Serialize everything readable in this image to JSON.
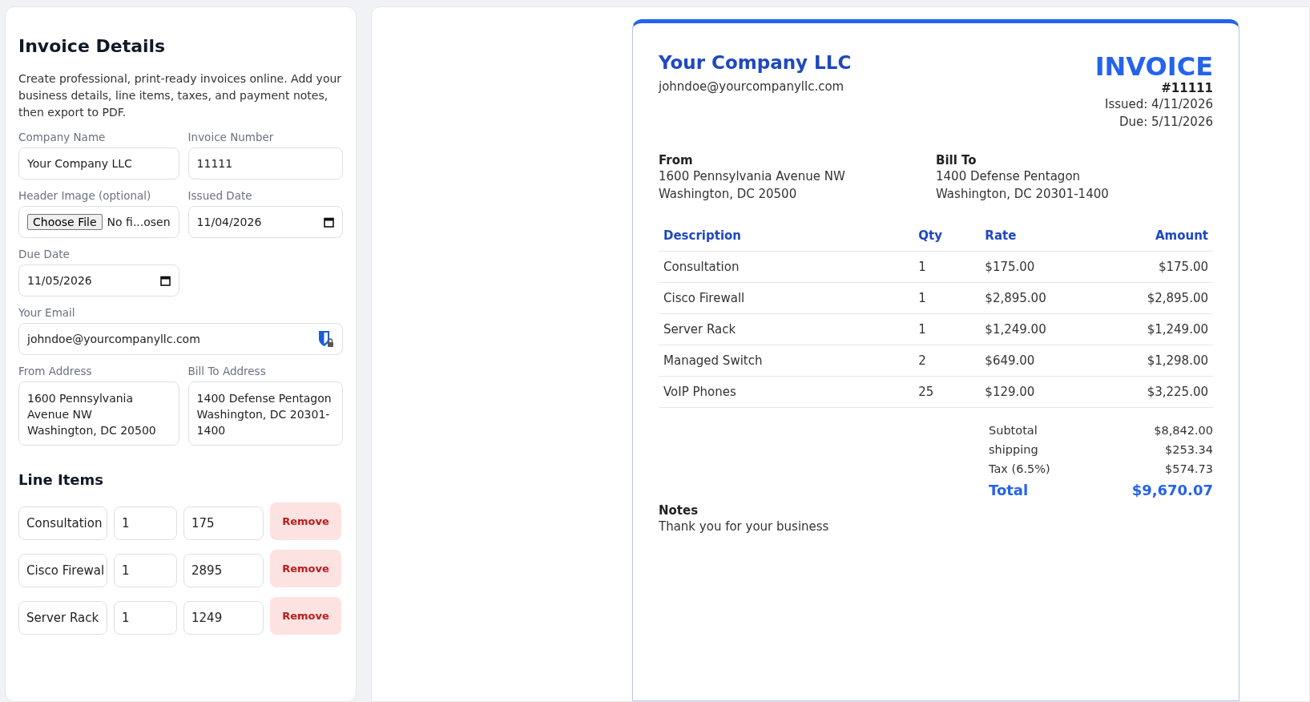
{
  "form": {
    "title": "Invoice Details",
    "intro": "Create professional, print-ready invoices online. Add your business details, line items, taxes, and payment notes, then export to PDF.",
    "company_name": {
      "label": "Company Name",
      "value": "Your Company LLC"
    },
    "invoice_number": {
      "label": "Invoice Number",
      "value": "11111"
    },
    "header_image": {
      "label": "Header Image (optional)",
      "button": "Choose File",
      "status": "No fi...osen"
    },
    "issued_date": {
      "label": "Issued Date",
      "value": "11/04/2026"
    },
    "due_date": {
      "label": "Due Date",
      "value": "11/05/2026"
    },
    "email": {
      "label": "Your Email",
      "value": "johndoe@yourcompanyllc.com"
    },
    "from_address": {
      "label": "From Address",
      "value": "1600 Pennsylvania Avenue NW\nWashington, DC 20500"
    },
    "bill_to_address": {
      "label": "Bill To Address",
      "value": "1400 Defense Pentagon\nWashington, DC 20301-1400"
    },
    "line_items_title": "Line Items",
    "line_items": [
      {
        "description": "Consultation",
        "qty": "1",
        "rate": "175",
        "remove": "Remove"
      },
      {
        "description": "Cisco Firewal",
        "qty": "1",
        "rate": "2895",
        "remove": "Remove"
      },
      {
        "description": "Server Rack",
        "qty": "1",
        "rate": "1249",
        "remove": "Remove"
      }
    ]
  },
  "invoice": {
    "company": "Your Company LLC",
    "email": "johndoe@yourcompanyllc.com",
    "title": "INVOICE",
    "number": "#11111",
    "issued": "Issued: 4/11/2026",
    "due": "Due: 5/11/2026",
    "from": {
      "label": "From",
      "lines": [
        "1600 Pennsylvania Avenue NW",
        "Washington, DC 20500"
      ]
    },
    "bill_to": {
      "label": "Bill To",
      "lines": [
        "1400 Defense Pentagon",
        "Washington, DC 20301-1400"
      ]
    },
    "columns": [
      "Description",
      "Qty",
      "Rate",
      "Amount"
    ],
    "rows": [
      [
        "Consultation",
        "1",
        "$175.00",
        "$175.00"
      ],
      [
        "Cisco Firewall",
        "1",
        "$2,895.00",
        "$2,895.00"
      ],
      [
        "Server Rack",
        "1",
        "$1,249.00",
        "$1,249.00"
      ],
      [
        "Managed Switch",
        "2",
        "$649.00",
        "$1,298.00"
      ],
      [
        "VoIP Phones",
        "25",
        "$129.00",
        "$3,225.00"
      ]
    ],
    "totals": [
      {
        "kind": "plain",
        "label": "Subtotal",
        "value": "$8,842.00"
      },
      {
        "kind": "plain",
        "label": "shipping",
        "value": "$253.34"
      },
      {
        "kind": "plain",
        "label": "Tax (6.5%)",
        "value": "$574.73"
      },
      {
        "kind": "grand",
        "label": "Total",
        "value": "$9,670.07"
      }
    ],
    "notes": {
      "label": "Notes",
      "text": "Thank you for your business"
    }
  }
}
